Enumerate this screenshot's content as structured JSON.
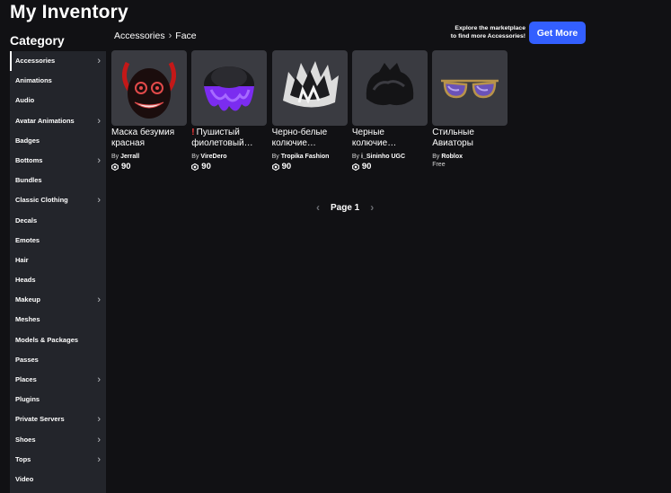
{
  "page_title": "My Inventory",
  "sidebar": {
    "heading": "Category",
    "items": [
      {
        "label": "Accessories",
        "chevron": true,
        "active": true
      },
      {
        "label": "Animations",
        "chevron": false
      },
      {
        "label": "Audio",
        "chevron": false
      },
      {
        "label": "Avatar Animations",
        "chevron": true
      },
      {
        "label": "Badges",
        "chevron": false
      },
      {
        "label": "Bottoms",
        "chevron": true
      },
      {
        "label": "Bundles",
        "chevron": false
      },
      {
        "label": "Classic Clothing",
        "chevron": true
      },
      {
        "label": "Decals",
        "chevron": false
      },
      {
        "label": "Emotes",
        "chevron": false
      },
      {
        "label": "Hair",
        "chevron": false
      },
      {
        "label": "Heads",
        "chevron": false
      },
      {
        "label": "Makeup",
        "chevron": true
      },
      {
        "label": "Meshes",
        "chevron": false
      },
      {
        "label": "Models & Packages",
        "chevron": false
      },
      {
        "label": "Passes",
        "chevron": false
      },
      {
        "label": "Places",
        "chevron": true
      },
      {
        "label": "Plugins",
        "chevron": false
      },
      {
        "label": "Private Servers",
        "chevron": true
      },
      {
        "label": "Shoes",
        "chevron": true
      },
      {
        "label": "Tops",
        "chevron": true
      },
      {
        "label": "Video",
        "chevron": false
      }
    ]
  },
  "breadcrumb": {
    "parent": "Accessories",
    "separator": "›",
    "current": "Face"
  },
  "promo": {
    "line1": "Explore the marketplace",
    "line2": "to find more Accessories!",
    "button_label": "Get More"
  },
  "items": [
    {
      "name": "Маска безумия красная",
      "warning": false,
      "by": "By",
      "creator": "Jerrall",
      "price": "90",
      "free": false,
      "icon": "demon-mask-icon"
    },
    {
      "name": "Пушистый фиолетовый…",
      "warning": true,
      "by": "By",
      "creator": "VireDero",
      "price": "90",
      "free": false,
      "icon": "purple-hair-icon"
    },
    {
      "name": "Черно-белые колючие…",
      "warning": false,
      "by": "By",
      "creator": "Tropika Fashion",
      "price": "90",
      "free": false,
      "icon": "spiky-bw-hair-icon"
    },
    {
      "name": "Черные колючие…",
      "warning": false,
      "by": "By",
      "creator": "i_Sininho UGC",
      "price": "90",
      "free": false,
      "icon": "black-hair-icon"
    },
    {
      "name": "Стильные Авиаторы",
      "warning": false,
      "by": "By",
      "creator": "Roblox",
      "price": "Free",
      "free": true,
      "icon": "aviator-glasses-icon"
    }
  ],
  "pager": {
    "label": "Page 1"
  },
  "colors": {
    "background": "#111114",
    "sidebar": "#23252b",
    "accent": "#335fff",
    "card": "#3a3b41"
  }
}
